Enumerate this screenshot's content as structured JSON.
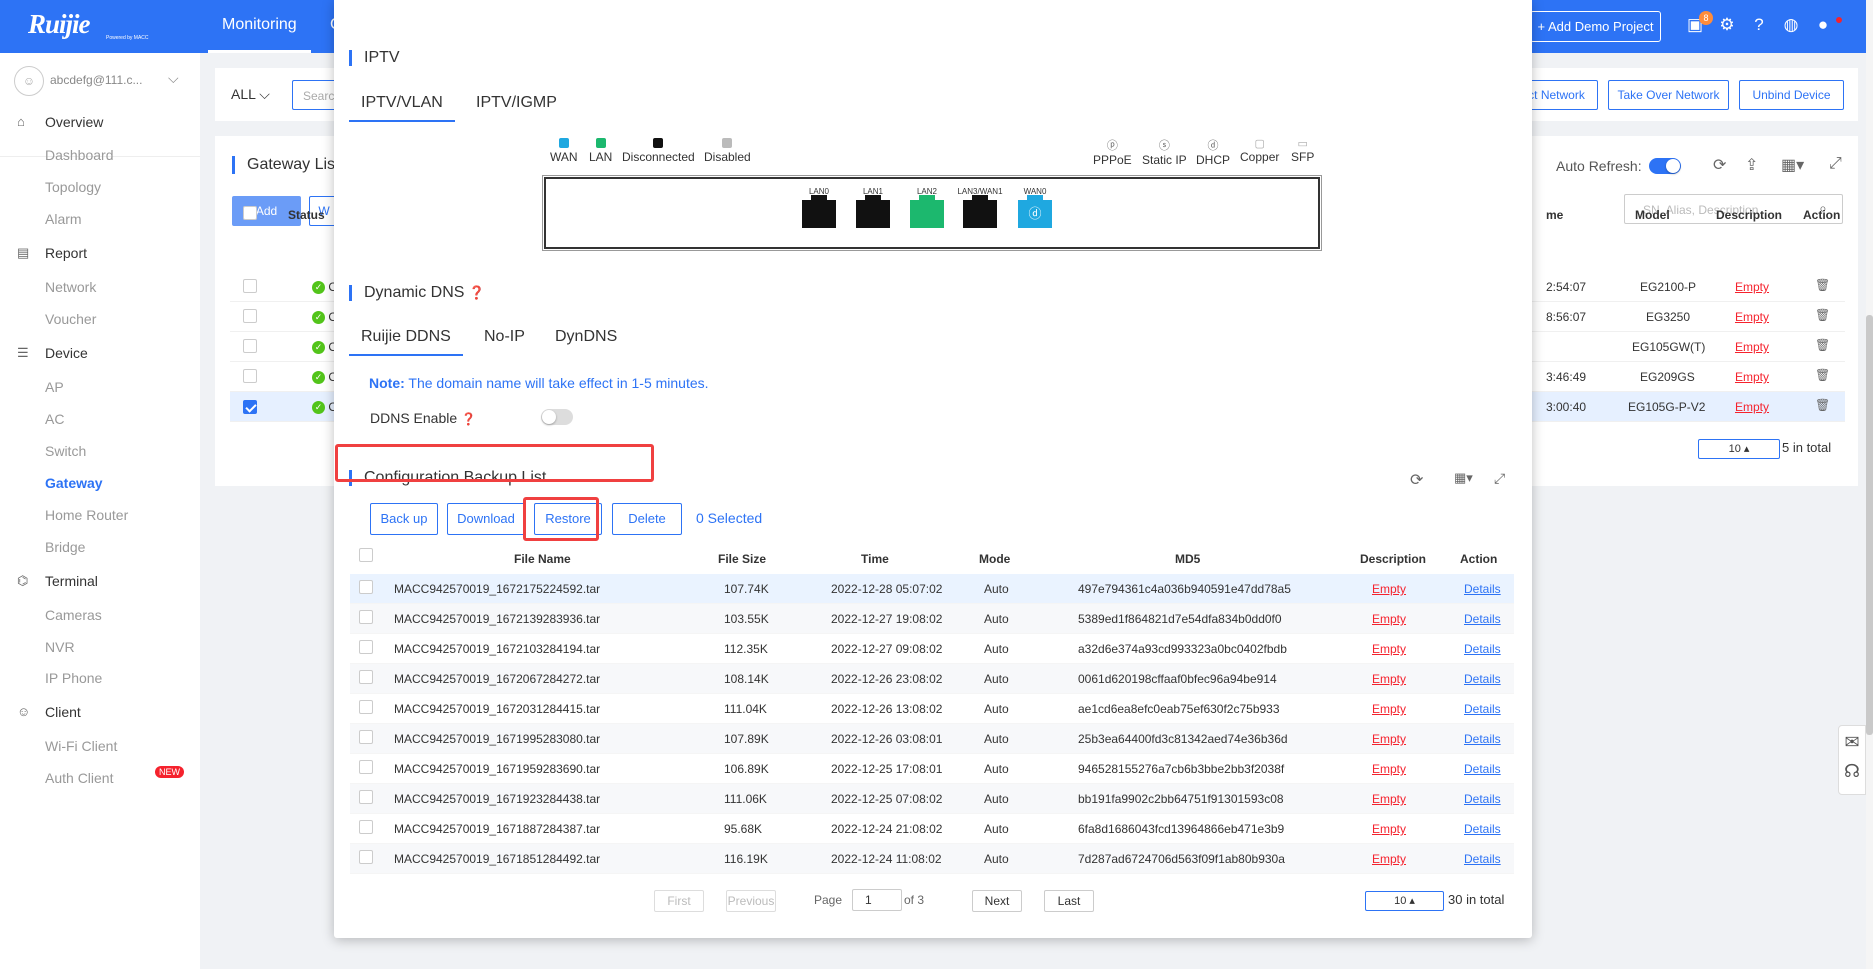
{
  "topbar": {
    "logo": "Ruijie",
    "logo_sub": "Powered by MACC",
    "nav_monitoring": "Monitoring",
    "nav_partial": "C",
    "add_demo": "+ Add Demo Project",
    "gift_badge": "8"
  },
  "sidebar": {
    "account": "abcdefg@111.c...",
    "groups": [
      {
        "label": "Overview",
        "icon": "home-icon"
      },
      {
        "label": "Report",
        "icon": "report-icon"
      },
      {
        "label": "Device",
        "icon": "device-icon"
      },
      {
        "label": "Terminal",
        "icon": "terminal-icon"
      },
      {
        "label": "Client",
        "icon": "client-icon"
      }
    ],
    "items": [
      "Dashboard",
      "Topology",
      "Alarm",
      "Network",
      "Voucher",
      "AP",
      "AC",
      "Switch",
      "Gateway",
      "Home Router",
      "Bridge",
      "Cameras",
      "NVR",
      "IP Phone",
      "Wi-Fi Client",
      "Auth Client"
    ],
    "new_badge": "NEW"
  },
  "background": {
    "filter_all": "ALL",
    "search_placeholder": "Searc",
    "btn_project_network": "ct Network",
    "btn_takeover": "Take Over Network",
    "btn_unbind": "Unbind Device",
    "gateway_list_title": "Gateway Lis",
    "add_label": "Add",
    "w_label": "W",
    "auto_refresh": "Auto Refresh:",
    "search2_placeholder": "SN, Alias, Description",
    "col_status": "Status",
    "col_time": "me",
    "col_model": "Model",
    "col_description": "Description",
    "col_action": "Action",
    "rows": [
      {
        "status": "Onli",
        "time": "2:54:07",
        "model": "EG2100-P",
        "desc": "Empty"
      },
      {
        "status": "Onli",
        "time": "8:56:07",
        "model": "EG3250",
        "desc": "Empty"
      },
      {
        "status": "Onli",
        "time": "",
        "model": "EG105GW(T)",
        "desc": "Empty"
      },
      {
        "status": "Onli",
        "time": "3:46:49",
        "model": "EG209GS",
        "desc": "Empty"
      },
      {
        "status": "Onli",
        "time": "3:00:40",
        "model": "EG105G-P-V2",
        "desc": "Empty"
      }
    ],
    "page_size": "10",
    "total": "5 in total"
  },
  "modal": {
    "iptv_title": "IPTV",
    "iptv_tabs": [
      "IPTV/VLAN",
      "IPTV/IGMP"
    ],
    "legend_left": [
      {
        "label": "WAN",
        "color": "#1fa8e0"
      },
      {
        "label": "LAN",
        "color": "#1cb86e"
      },
      {
        "label": "Disconnected",
        "color": "#111111"
      },
      {
        "label": "Disabled",
        "color": "#bbbbbb"
      }
    ],
    "legend_right": [
      {
        "label": "PPPoE",
        "glyph": "P"
      },
      {
        "label": "Static IP",
        "glyph": "S"
      },
      {
        "label": "DHCP",
        "glyph": "D"
      },
      {
        "label": "Copper",
        "glyph": ""
      },
      {
        "label": "SFP",
        "glyph": ""
      }
    ],
    "ports": [
      {
        "label": "LAN0",
        "color": "#111111",
        "glyph": ""
      },
      {
        "label": "LAN1",
        "color": "#111111",
        "glyph": ""
      },
      {
        "label": "LAN2",
        "color": "#1cb86e",
        "glyph": ""
      },
      {
        "label": "LAN3/WAN1",
        "color": "#111111",
        "glyph": ""
      },
      {
        "label": "WAN0",
        "color": "#1fa8e0",
        "glyph": "D"
      }
    ],
    "ddns_title": "Dynamic DNS",
    "ddns_tabs": [
      "Ruijie DDNS",
      "No-IP",
      "DynDNS"
    ],
    "note_label": "Note:",
    "note_text": " The domain name will take effect in 1-5 minutes.",
    "ddns_enable": "DDNS Enable",
    "backup_title": "Configuration Backup List",
    "btn_backup": "Back up",
    "btn_download": "Download",
    "btn_restore": "Restore",
    "btn_delete": "Delete",
    "selected": "0 Selected",
    "columns": [
      "File Name",
      "File Size",
      "Time",
      "Mode",
      "MD5",
      "Description",
      "Action"
    ],
    "rows": [
      {
        "file": "MACC942570019_1672175224592.tar",
        "size": "107.74K",
        "time": "2022-12-28 05:07:02",
        "mode": "Auto",
        "md5": "497e794361c4a036b940591e47dd78a5",
        "desc": "Empty",
        "action": "Details"
      },
      {
        "file": "MACC942570019_1672139283936.tar",
        "size": "103.55K",
        "time": "2022-12-27 19:08:02",
        "mode": "Auto",
        "md5": "5389ed1f864821d7e54dfa834b0dd0f0",
        "desc": "Empty",
        "action": "Details"
      },
      {
        "file": "MACC942570019_1672103284194.tar",
        "size": "112.35K",
        "time": "2022-12-27 09:08:02",
        "mode": "Auto",
        "md5": "a32d6e374a93cd993323a0bc0402fbdb",
        "desc": "Empty",
        "action": "Details"
      },
      {
        "file": "MACC942570019_1672067284272.tar",
        "size": "108.14K",
        "time": "2022-12-26 23:08:02",
        "mode": "Auto",
        "md5": "0061d620198cffaaf0bfec96a94be914",
        "desc": "Empty",
        "action": "Details"
      },
      {
        "file": "MACC942570019_1672031284415.tar",
        "size": "111.04K",
        "time": "2022-12-26 13:08:02",
        "mode": "Auto",
        "md5": "ae1cd6ea8efc0eab75ef630f2c75b933",
        "desc": "Empty",
        "action": "Details"
      },
      {
        "file": "MACC942570019_1671995283080.tar",
        "size": "107.89K",
        "time": "2022-12-26 03:08:01",
        "mode": "Auto",
        "md5": "25b3ea64400fd3c81342aed74e36b36d",
        "desc": "Empty",
        "action": "Details"
      },
      {
        "file": "MACC942570019_1671959283690.tar",
        "size": "106.89K",
        "time": "2022-12-25 17:08:01",
        "mode": "Auto",
        "md5": "946528155276a7cb6b3bbe2bb3f2038f",
        "desc": "Empty",
        "action": "Details"
      },
      {
        "file": "MACC942570019_1671923284438.tar",
        "size": "111.06K",
        "time": "2022-12-25 07:08:02",
        "mode": "Auto",
        "md5": "bb191fa9902c2bb64751f91301593c08",
        "desc": "Empty",
        "action": "Details"
      },
      {
        "file": "MACC942570019_1671887284387.tar",
        "size": "95.68K",
        "time": "2022-12-24 21:08:02",
        "mode": "Auto",
        "md5": "6fa8d1686043fcd13964866eb471e3b9",
        "desc": "Empty",
        "action": "Details"
      },
      {
        "file": "MACC942570019_1671851284492.tar",
        "size": "116.19K",
        "time": "2022-12-24 11:08:02",
        "mode": "Auto",
        "md5": "7d287ad6724706d563f09f1ab80b930a",
        "desc": "Empty",
        "action": "Details"
      }
    ],
    "pagination": {
      "first": "First",
      "previous": "Previous",
      "page_label": "Page",
      "page_value": "1",
      "of_label": "of 3",
      "next": "Next",
      "last": "Last",
      "page_size": "10",
      "total": "30 in total"
    }
  },
  "colors": {
    "accent": "#2d73f5",
    "danger": "#f5222d",
    "highlight_box": "#f04040"
  }
}
